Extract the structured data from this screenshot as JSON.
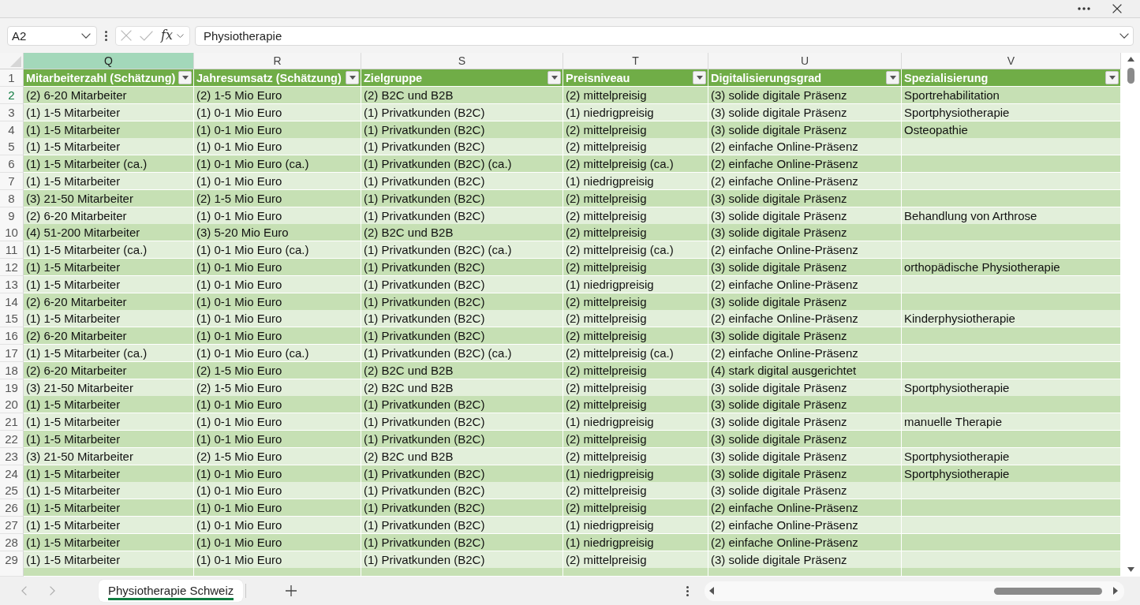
{
  "formula_bar": {
    "name_box": "A2",
    "edit_buttons": [
      {
        "kind": "cancel",
        "disabled": true
      },
      {
        "kind": "enter",
        "disabled": true
      }
    ],
    "function_label": "fx",
    "formula": "Physiotherapie"
  },
  "column_headers": [
    {
      "letter": "Q",
      "selected": true
    },
    {
      "letter": "R",
      "selected": false
    },
    {
      "letter": "S",
      "selected": false
    },
    {
      "letter": "T",
      "selected": false
    },
    {
      "letter": "U",
      "selected": false
    },
    {
      "letter": "V",
      "selected": false
    }
  ],
  "table": {
    "header_row_number": "1",
    "columns": [
      {
        "label": "Mitarbeiterzahl (Schätzung)"
      },
      {
        "label": "Jahresumsatz (Schätzung)"
      },
      {
        "label": "Zielgruppe"
      },
      {
        "label": "Preisniveau"
      },
      {
        "label": "Digitalisierungsgrad"
      },
      {
        "label": "Spezialisierung"
      }
    ],
    "rows": [
      {
        "number": "2",
        "selected": true,
        "cells": [
          "(2) 6-20 Mitarbeiter",
          "(2) 1-5 Mio Euro",
          "(2) B2C und B2B",
          "(2) mittelpreisig",
          "(3) solide digitale Präsenz",
          "Sportrehabilitation"
        ]
      },
      {
        "number": "3",
        "selected": false,
        "cells": [
          "(1) 1-5 Mitarbeiter",
          "(1) 0-1 Mio Euro",
          "(1) Privatkunden (B2C)",
          "(1) niedrigpreisig",
          "(3) solide digitale Präsenz",
          "Sportphysiotherapie"
        ]
      },
      {
        "number": "4",
        "selected": false,
        "cells": [
          "(1) 1-5 Mitarbeiter",
          "(1) 0-1 Mio Euro",
          "(1) Privatkunden (B2C)",
          "(2) mittelpreisig",
          "(3) solide digitale Präsenz",
          "Osteopathie"
        ]
      },
      {
        "number": "5",
        "selected": false,
        "cells": [
          "(1) 1-5 Mitarbeiter",
          "(1) 0-1 Mio Euro",
          "(1) Privatkunden (B2C)",
          "(2) mittelpreisig",
          "(2) einfache Online-Präsenz"
        ]
      },
      {
        "number": "6",
        "selected": false,
        "cells": [
          "(1) 1-5 Mitarbeiter (ca.)",
          "(1) 0-1 Mio Euro (ca.)",
          "(1) Privatkunden (B2C) (ca.)",
          "(2) mittelpreisig (ca.)",
          "(2) einfache Online-Präsenz"
        ]
      },
      {
        "number": "7",
        "selected": false,
        "cells": [
          "(1) 1-5 Mitarbeiter",
          "(1) 0-1 Mio Euro",
          "(1) Privatkunden (B2C)",
          "(1) niedrigpreisig",
          "(2) einfache Online-Präsenz"
        ]
      },
      {
        "number": "8",
        "selected": false,
        "cells": [
          "(3) 21-50 Mitarbeiter",
          "(2) 1-5 Mio Euro",
          "(1) Privatkunden (B2C)",
          "(2) mittelpreisig",
          "(3) solide digitale Präsenz"
        ]
      },
      {
        "number": "9",
        "selected": false,
        "cells": [
          "(2) 6-20 Mitarbeiter",
          "(1) 0-1 Mio Euro",
          "(1) Privatkunden (B2C)",
          "(2) mittelpreisig",
          "(3) solide digitale Präsenz",
          "Behandlung von Arthrose"
        ]
      },
      {
        "number": "10",
        "selected": false,
        "cells": [
          "(4) 51-200 Mitarbeiter",
          "(3) 5-20 Mio Euro",
          "(2) B2C und B2B",
          "(2) mittelpreisig",
          "(3) solide digitale Präsenz"
        ]
      },
      {
        "number": "11",
        "selected": false,
        "cells": [
          "(1) 1-5 Mitarbeiter (ca.)",
          "(1) 0-1 Mio Euro (ca.)",
          "(1) Privatkunden (B2C) (ca.)",
          "(2) mittelpreisig (ca.)",
          "(2) einfache Online-Präsenz"
        ]
      },
      {
        "number": "12",
        "selected": false,
        "cells": [
          "(1) 1-5 Mitarbeiter",
          "(1) 0-1 Mio Euro",
          "(1) Privatkunden (B2C)",
          "(2) mittelpreisig",
          "(3) solide digitale Präsenz",
          "orthopädische Physiotherapie"
        ]
      },
      {
        "number": "13",
        "selected": false,
        "cells": [
          "(1) 1-5 Mitarbeiter",
          "(1) 0-1 Mio Euro",
          "(1) Privatkunden (B2C)",
          "(1) niedrigpreisig",
          "(2) einfache Online-Präsenz"
        ]
      },
      {
        "number": "14",
        "selected": false,
        "cells": [
          "(2) 6-20 Mitarbeiter",
          "(1) 0-1 Mio Euro",
          "(1) Privatkunden (B2C)",
          "(2) mittelpreisig",
          "(3) solide digitale Präsenz"
        ]
      },
      {
        "number": "15",
        "selected": false,
        "cells": [
          "(1) 1-5 Mitarbeiter",
          "(1) 0-1 Mio Euro",
          "(1) Privatkunden (B2C)",
          "(2) mittelpreisig",
          "(2) einfache Online-Präsenz",
          "Kinderphysiotherapie"
        ]
      },
      {
        "number": "16",
        "selected": false,
        "cells": [
          "(2) 6-20 Mitarbeiter",
          "(1) 0-1 Mio Euro",
          "(1) Privatkunden (B2C)",
          "(2) mittelpreisig",
          "(3) solide digitale Präsenz"
        ]
      },
      {
        "number": "17",
        "selected": false,
        "cells": [
          "(1) 1-5 Mitarbeiter (ca.)",
          "(1) 0-1 Mio Euro (ca.)",
          "(1) Privatkunden (B2C) (ca.)",
          "(2) mittelpreisig (ca.)",
          "(2) einfache Online-Präsenz"
        ]
      },
      {
        "number": "18",
        "selected": false,
        "cells": [
          "(2) 6-20 Mitarbeiter",
          "(2) 1-5 Mio Euro",
          "(2) B2C und B2B",
          "(2) mittelpreisig",
          "(4) stark digital ausgerichtet"
        ]
      },
      {
        "number": "19",
        "selected": false,
        "cells": [
          "(3) 21-50 Mitarbeiter",
          "(2) 1-5 Mio Euro",
          "(2) B2C und B2B",
          "(2) mittelpreisig",
          "(3) solide digitale Präsenz",
          "Sportphysiotherapie"
        ]
      },
      {
        "number": "20",
        "selected": false,
        "cells": [
          "(1) 1-5 Mitarbeiter",
          "(1) 0-1 Mio Euro",
          "(1) Privatkunden (B2C)",
          "(2) mittelpreisig",
          "(3) solide digitale Präsenz"
        ]
      },
      {
        "number": "21",
        "selected": false,
        "cells": [
          "(1) 1-5 Mitarbeiter",
          "(1) 0-1 Mio Euro",
          "(1) Privatkunden (B2C)",
          "(1) niedrigpreisig",
          "(3) solide digitale Präsenz",
          "manuelle Therapie"
        ]
      },
      {
        "number": "22",
        "selected": false,
        "cells": [
          "(1) 1-5 Mitarbeiter",
          "(1) 0-1 Mio Euro",
          "(1) Privatkunden (B2C)",
          "(2) mittelpreisig",
          "(3) solide digitale Präsenz"
        ]
      },
      {
        "number": "23",
        "selected": false,
        "cells": [
          "(3) 21-50 Mitarbeiter",
          "(2) 1-5 Mio Euro",
          "(2) B2C und B2B",
          "(2) mittelpreisig",
          "(3) solide digitale Präsenz",
          "Sportphysiotherapie"
        ]
      },
      {
        "number": "24",
        "selected": false,
        "cells": [
          "(1) 1-5 Mitarbeiter",
          "(1) 0-1 Mio Euro",
          "(1) Privatkunden (B2C)",
          "(1) niedrigpreisig",
          "(3) solide digitale Präsenz",
          "Sportphysiotherapie"
        ]
      },
      {
        "number": "25",
        "selected": false,
        "cells": [
          "(1) 1-5 Mitarbeiter",
          "(1) 0-1 Mio Euro",
          "(1) Privatkunden (B2C)",
          "(2) mittelpreisig",
          "(3) solide digitale Präsenz"
        ]
      },
      {
        "number": "26",
        "selected": false,
        "cells": [
          "(1) 1-5 Mitarbeiter",
          "(1) 0-1 Mio Euro",
          "(1) Privatkunden (B2C)",
          "(2) mittelpreisig",
          "(2) einfache Online-Präsenz"
        ]
      },
      {
        "number": "27",
        "selected": false,
        "cells": [
          "(1) 1-5 Mitarbeiter",
          "(1) 0-1 Mio Euro",
          "(1) Privatkunden (B2C)",
          "(1) niedrigpreisig",
          "(2) einfache Online-Präsenz"
        ]
      },
      {
        "number": "28",
        "selected": false,
        "cells": [
          "(1) 1-5 Mitarbeiter",
          "(1) 0-1 Mio Euro",
          "(1) Privatkunden (B2C)",
          "(1) niedrigpreisig",
          "(2) einfache Online-Präsenz"
        ]
      },
      {
        "number": "29",
        "selected": false,
        "cells": [
          "(1) 1-5 Mitarbeiter",
          "(1) 0-1 Mio Euro",
          "(1) Privatkunden (B2C)",
          "(2) mittelpreisig",
          "(3) solide digitale Präsenz"
        ]
      }
    ]
  },
  "sheet_tabs": [
    {
      "label": "Physiotherapie Schweiz",
      "selected": true
    }
  ]
}
